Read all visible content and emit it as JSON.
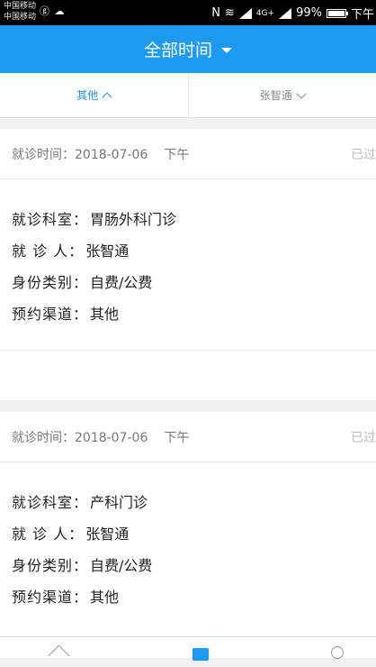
{
  "status_bar": {
    "carrier_1": "中国移动",
    "carrier_2": "中国移动",
    "left_icons": "ⓖ ☁",
    "network_4g": "4G+",
    "battery": "99%",
    "time": "下午"
  },
  "header": {
    "title": "全部时间"
  },
  "filters": {
    "left_label": "其他",
    "right_label": "张智通"
  },
  "appointments": [
    {
      "time_label": "就诊时间：",
      "date": "2018-07-06",
      "period": "下午",
      "status": "已过",
      "fields": [
        {
          "label": "就诊科室：",
          "value": "胃肠外科门诊"
        },
        {
          "label": "就 诊 人：",
          "value": "张智通"
        },
        {
          "label": "身份类别：",
          "value": "自费/公费"
        },
        {
          "label": "预约渠道：",
          "value": "其他"
        }
      ]
    },
    {
      "time_label": "就诊时间：",
      "date": "2018-07-06",
      "period": "下午",
      "status": "已过",
      "fields": [
        {
          "label": "就诊科室：",
          "value": "产科门诊"
        },
        {
          "label": "就 诊 人：",
          "value": "张智通"
        },
        {
          "label": "身份类别：",
          "value": "自费/公费"
        },
        {
          "label": "预约渠道：",
          "value": "其他"
        }
      ]
    }
  ],
  "colors": {
    "header_bg": "#1e9bf0",
    "filter_active": "#1e8fe0",
    "page_bg": "#f1f1f1"
  },
  "icons": [
    "home-icon",
    "clipboard-icon",
    "user-icon"
  ]
}
